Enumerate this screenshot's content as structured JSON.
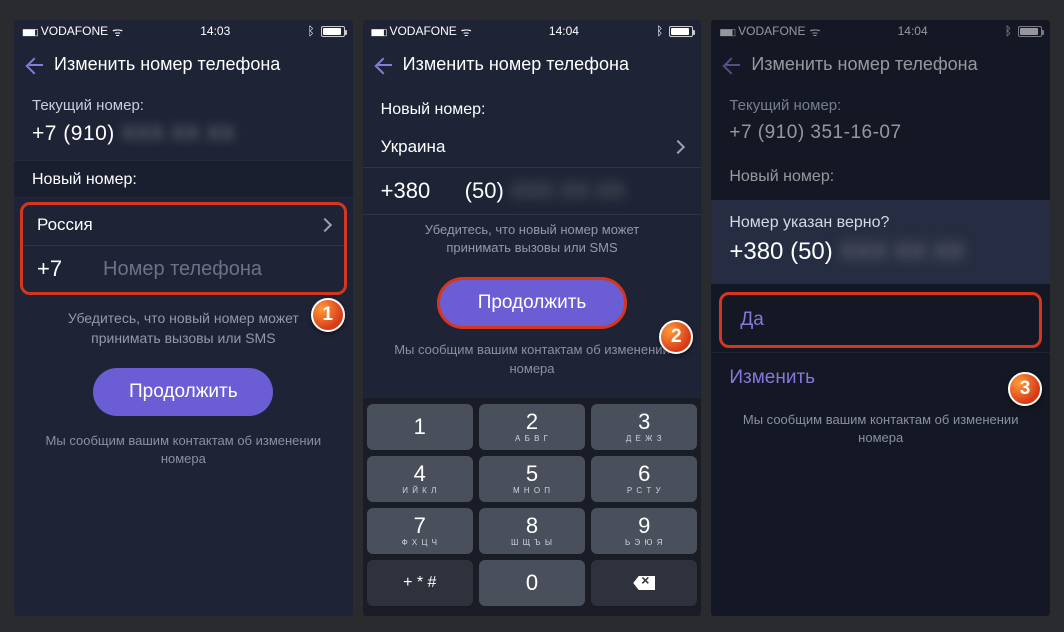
{
  "status": {
    "carrier": "VODAFONE",
    "time1": "14:03",
    "time2": "14:04",
    "time3": "14:04"
  },
  "header": {
    "title": "Изменить номер телефона"
  },
  "s1": {
    "current_label": "Текущий номер:",
    "current_value": "+7 (910)",
    "new_label": "Новый номер:",
    "country": "Россия",
    "prefix": "+7",
    "placeholder": "Номер телефона",
    "hint": "Убедитесь, что новый номер может принимать вызовы или SMS",
    "cta": "Продолжить",
    "footnote": "Мы сообщим вашим контактам об изменении номера"
  },
  "s2": {
    "new_label": "Новый номер:",
    "country": "Украина",
    "prefix": "+380",
    "area": "(50)",
    "hint": "Убедитесь, что новый номер может принимать вызовы или SMS",
    "cta": "Продолжить",
    "footnote": "Мы сообщим вашим контактам об изменении номера",
    "keys": [
      {
        "d": "1",
        "l": ""
      },
      {
        "d": "2",
        "l": "А Б В Г"
      },
      {
        "d": "3",
        "l": "Д Е Ж З"
      },
      {
        "d": "4",
        "l": "И Й К Л"
      },
      {
        "d": "5",
        "l": "М Н О П"
      },
      {
        "d": "6",
        "l": "Р С Т У"
      },
      {
        "d": "7",
        "l": "Ф Х Ц Ч"
      },
      {
        "d": "8",
        "l": "Ш Щ Ъ Ы"
      },
      {
        "d": "9",
        "l": "Ь Э Ю Я"
      },
      {
        "d": "+ * #",
        "l": ""
      },
      {
        "d": "0",
        "l": ""
      }
    ]
  },
  "s3": {
    "current_label": "Текущий номер:",
    "current_value": "+7 (910) 351-16-07",
    "new_label": "Новый номер:",
    "confirm_q": "Номер указан верно?",
    "confirm_num_prefix": "+380 (50)",
    "yes": "Да",
    "change": "Изменить",
    "footnote": "Мы сообщим вашим контактам об изменении номера"
  },
  "badges": {
    "b1": "1",
    "b2": "2",
    "b3": "3"
  }
}
